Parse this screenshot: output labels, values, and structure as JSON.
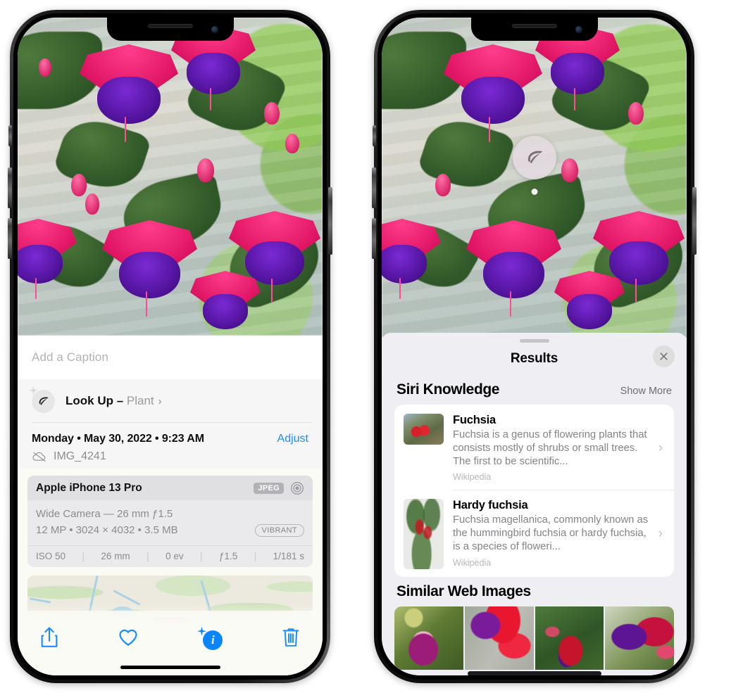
{
  "left_phone": {
    "photo": {
      "alt": "fuchsia-flowers-photo"
    },
    "caption_placeholder": "Add a Caption",
    "lookup": {
      "label": "Look Up",
      "dash": " – ",
      "subject": "Plant",
      "chevron": "›",
      "icon": "leaf-icon"
    },
    "metadata": {
      "date": "Monday • May 30, 2022 • 9:23 AM",
      "adjust_label": "Adjust",
      "filename": "IMG_4241",
      "cloud_icon": "cloud-slash-icon"
    },
    "camera_card": {
      "device": "Apple iPhone 13 Pro",
      "format_badge": "JPEG",
      "hdr_icon": "hdr-circles-icon",
      "lens": "Wide Camera — 26 mm ƒ1.5",
      "specs": "12 MP • 3024 × 4032 • 3.5 MB",
      "style_badge": "VIBRANT",
      "exif": [
        "ISO 50",
        "26 mm",
        "0 ev",
        "ƒ1.5",
        "1/181 s"
      ],
      "exif_separator": "|"
    },
    "map": {
      "pin": "photo-thumbnail-pin"
    },
    "toolbar": [
      {
        "name": "share-button",
        "icon": "share-icon"
      },
      {
        "name": "favorite-button",
        "icon": "heart-icon"
      },
      {
        "name": "info-button",
        "icon": "info-sparkle-icon",
        "glyph": "i"
      },
      {
        "name": "delete-button",
        "icon": "trash-icon"
      }
    ],
    "accent_color": "#1a8cff"
  },
  "right_phone": {
    "photo": {
      "alt": "fuchsia-flowers-photo"
    },
    "leaf_badge": {
      "icon": "leaf-icon"
    },
    "sheet": {
      "title": "Results",
      "close_icon": "close-icon",
      "sections": [
        {
          "title": "Siri Knowledge",
          "action": "Show More",
          "items": [
            {
              "title": "Fuchsia",
              "description": "Fuchsia is a genus of flowering plants that consists mostly of shrubs or small trees. The first to be scientific...",
              "source": "Wikipedia",
              "chevron": "›",
              "thumb": "red-fuchsia-outdoor-thumb"
            },
            {
              "title": "Hardy fuchsia",
              "description": "Fuchsia magellanica, commonly known as the hummingbird fuchsia or hardy fuchsia, is a species of floweri...",
              "source": "Wikipedia",
              "chevron": "›",
              "thumb": "hardy-fuchsia-specimen-thumb"
            }
          ]
        },
        {
          "title": "Similar Web Images",
          "images": [
            "similar-image-1",
            "similar-image-2",
            "similar-image-3",
            "similar-image-4"
          ]
        }
      ]
    }
  }
}
